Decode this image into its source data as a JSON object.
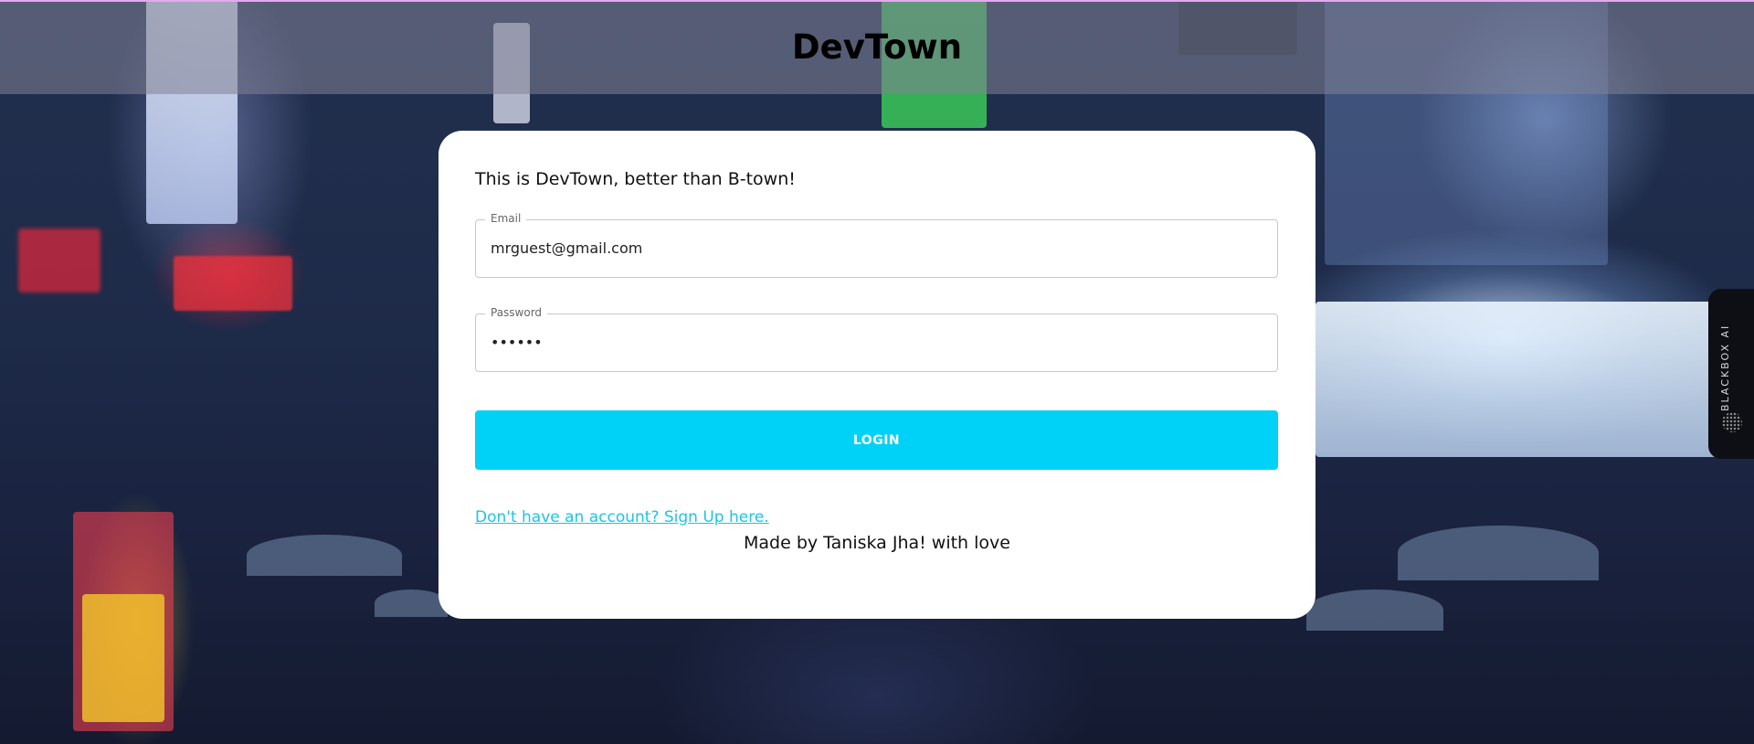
{
  "header": {
    "brand": "DevTown"
  },
  "login_card": {
    "tagline": "This is DevTown, better than B-town!",
    "email": {
      "label": "Email",
      "value": "mrguest@gmail.com"
    },
    "password": {
      "label": "Password",
      "value": "••••••"
    },
    "login_button": "LOGIN",
    "signup_link": "Don't have an account? Sign Up here.",
    "credit": "Made by Taniska Jha! with love"
  },
  "side_widget": {
    "label": "BLACKBOX AI"
  },
  "colors": {
    "accent": "#00d2f7",
    "link": "#1ec3e8"
  }
}
